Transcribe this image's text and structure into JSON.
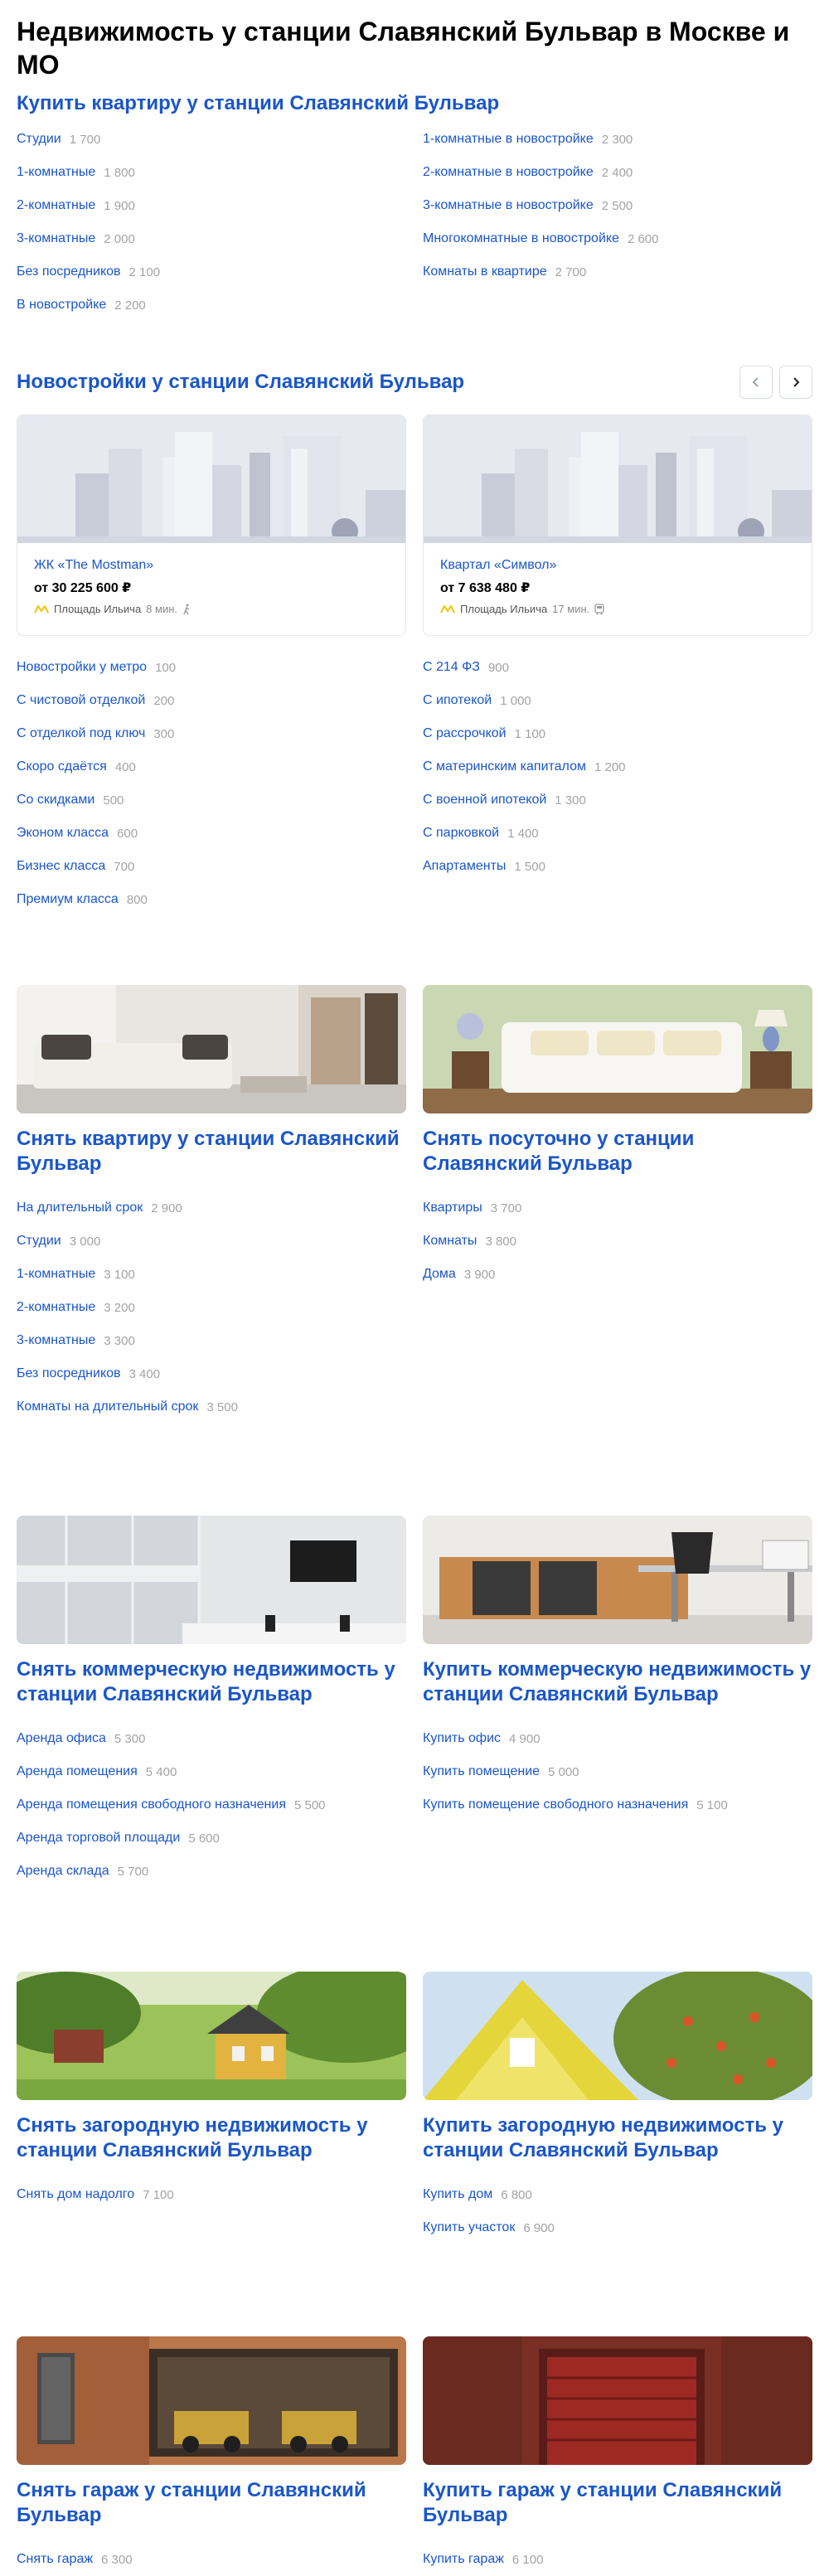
{
  "page_title": "Недвижимость у станции Славянский Бульвар в Москве и МО",
  "buy": {
    "heading": "Купить квартиру у станции Славянский Бульвар",
    "left": [
      {
        "label": "Студии",
        "count": "1 700"
      },
      {
        "label": "1-комнатные",
        "count": "1 800"
      },
      {
        "label": "2-комнатные",
        "count": "1 900"
      },
      {
        "label": "3-комнатные",
        "count": "2 000"
      },
      {
        "label": "Без посредников",
        "count": "2 100"
      },
      {
        "label": "В новостройке",
        "count": "2 200"
      }
    ],
    "right": [
      {
        "label": "1-комнатные в новостройке",
        "count": "2 300"
      },
      {
        "label": "2-комнатные в новостройке",
        "count": "2 400"
      },
      {
        "label": "3-комнатные в новостройке",
        "count": "2 500"
      },
      {
        "label": "Многокомнатные в новостройке",
        "count": "2 600"
      },
      {
        "label": "Комнаты в квартире",
        "count": "2 700"
      }
    ]
  },
  "newbuild": {
    "heading": "Новостройки у станции Славянский Бульвар",
    "prev_icon": "chevron-left-icon",
    "next_icon": "chevron-right-icon",
    "cards": [
      {
        "name": "ЖК «The Mostman»",
        "price": "от 30 225 600 ₽",
        "metro": "Площадь Ильича",
        "time": "8 мин.",
        "transport_icon": "walk-icon"
      },
      {
        "name": "Квартал «Символ»",
        "price": "от 7 638 480 ₽",
        "metro": "Площадь Ильича",
        "time": "17 мин.",
        "transport_icon": "bus-icon"
      }
    ],
    "left": [
      {
        "label": "Новостройки у метро",
        "count": "100"
      },
      {
        "label": "С чистовой отделкой",
        "count": "200"
      },
      {
        "label": "С отделкой под ключ",
        "count": "300"
      },
      {
        "label": "Скоро сдаётся",
        "count": "400"
      },
      {
        "label": "Со скидками",
        "count": "500"
      },
      {
        "label": "Эконом класса",
        "count": "600"
      },
      {
        "label": "Бизнес класса",
        "count": "700"
      },
      {
        "label": "Премиум класса",
        "count": "800"
      }
    ],
    "right": [
      {
        "label": "С 214 ФЗ",
        "count": "900"
      },
      {
        "label": "С ипотекой",
        "count": "1 000"
      },
      {
        "label": "С рассрочкой",
        "count": "1 100"
      },
      {
        "label": "С материнским капиталом",
        "count": "1 200"
      },
      {
        "label": "С военной ипотекой",
        "count": "1 300"
      },
      {
        "label": "С парковкой",
        "count": "1 400"
      },
      {
        "label": "Апартаменты",
        "count": "1 500"
      }
    ]
  },
  "rent": {
    "left": {
      "heading": "Снять квартиру у станции Славянский Бульвар",
      "items": [
        {
          "label": "На длительный срок",
          "count": "2 900"
        },
        {
          "label": "Студии",
          "count": "3 000"
        },
        {
          "label": "1-комнатные",
          "count": "3 100"
        },
        {
          "label": "2-комнатные",
          "count": "3 200"
        },
        {
          "label": "3-комнатные",
          "count": "3 300"
        },
        {
          "label": "Без посредников",
          "count": "3 400"
        },
        {
          "label": "Комнаты на длительный срок",
          "count": "3 500"
        }
      ]
    },
    "right": {
      "heading": "Снять посуточно у станции Славянский Бульвар",
      "items": [
        {
          "label": "Квартиры",
          "count": "3 700"
        },
        {
          "label": "Комнаты",
          "count": "3 800"
        },
        {
          "label": "Дома",
          "count": "3 900"
        }
      ]
    }
  },
  "commercial": {
    "left": {
      "heading": "Снять коммерческую недвижимость у станции Славянский Бульвар",
      "items": [
        {
          "label": "Аренда офиса",
          "count": "5 300"
        },
        {
          "label": "Аренда помещения",
          "count": "5 400"
        },
        {
          "label": "Аренда помещения свободного назначения",
          "count": "5 500"
        },
        {
          "label": "Аренда торговой площади",
          "count": "5 600"
        },
        {
          "label": "Аренда склада",
          "count": "5 700"
        }
      ]
    },
    "right": {
      "heading": "Купить коммерческую недвижимость у станции Славянский Бульвар",
      "items": [
        {
          "label": "Купить офис",
          "count": "4 900"
        },
        {
          "label": "Купить помещение",
          "count": "5 000"
        },
        {
          "label": "Купить помещение свободного назначения",
          "count": "5 100"
        }
      ]
    }
  },
  "country": {
    "left": {
      "heading": "Снять загородную недвижимость у станции Славянский Бульвар",
      "items": [
        {
          "label": "Снять дом надолго",
          "count": "7 100"
        }
      ]
    },
    "right": {
      "heading": "Купить загородную недвижимость у станции Славянский Бульвар",
      "items": [
        {
          "label": "Купить дом",
          "count": "6 800"
        },
        {
          "label": "Купить участок",
          "count": "6 900"
        }
      ]
    }
  },
  "garage": {
    "left": {
      "heading": "Снять гараж у станции Славянский Бульвар",
      "items": [
        {
          "label": "Снять гараж",
          "count": "6 300"
        }
      ]
    },
    "right": {
      "heading": "Купить гараж у станции Славянский Бульвар",
      "items": [
        {
          "label": "Купить гараж",
          "count": "6 100"
        }
      ]
    }
  },
  "colors": {
    "link": "#1a56c8",
    "count": "#a3a3a3",
    "metro_line": "#f5c400"
  }
}
